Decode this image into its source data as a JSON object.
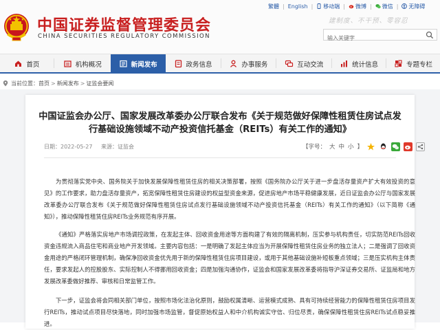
{
  "header": {
    "cn_title": "中国证券监督管理委员会",
    "en_title": "CHINA SECURITIES REGULATORY COMMISSION",
    "slogan": "建制度、不干预、零容忍",
    "top_links": {
      "traditional": "繁體",
      "english": "English",
      "mobile": "移动端",
      "weibo": "微博",
      "wechat": "微信",
      "accessibility": "无障碍"
    },
    "search_placeholder": "输入关键字"
  },
  "nav": {
    "items": [
      {
        "label": "首页",
        "icon": "home-icon"
      },
      {
        "label": "机构概况",
        "icon": "organization-icon"
      },
      {
        "label": "新闻发布",
        "icon": "news-icon",
        "active": true
      },
      {
        "label": "政务信息",
        "icon": "government-info-icon"
      },
      {
        "label": "办事服务",
        "icon": "service-icon"
      },
      {
        "label": "互动交流",
        "icon": "interaction-icon"
      },
      {
        "label": "统计信息",
        "icon": "statistics-icon"
      },
      {
        "label": "专题专栏",
        "icon": "topics-icon"
      }
    ],
    "active_color": "#2c5fa8"
  },
  "breadcrumb": {
    "prefix": "当前位置：",
    "items": [
      "首页",
      "新闻发布",
      "证监会要闻"
    ],
    "separator": ">"
  },
  "article": {
    "title": "中国证监会办公厅、国家发展改革委办公厅联合发布《关于规范做好保障性租赁住房试点发行基础设施领域不动产投资信托基金（REITs）有关工作的通知》",
    "date": "日期：2022-05-27",
    "source": "来源：证监会",
    "font_size_label": "【字号：",
    "font_sizes": [
      "大",
      "中",
      "小"
    ],
    "font_size_close": "】",
    "paragraphs": [
      "为贯彻落实党中央、国务院关于加快发展保障性租赁住房的相关决策部署，按照《国务院办公厅关于进一步盘活存量资产扩大有效投资的意见》的工作要求，助力盘活存量资产，拓宽保障性租赁住房建设的权益型资金来源，促进房地产市场平稳健康发展，近日证监会办公厅与国家发展改革委办公厅联合发布《关于规范做好保障性租赁住房试点发行基础设施领域不动产投资信托基金（REITs）有关工作的通知》（以下简称《通知》），推动保障性租赁住房REITs业务规范有序开展。",
      "《通知》严格落实房地产市场调控政策，在发起主体、回收资金用途等方面构建了有效的隔离机制，压实参与机构责任，切实防范REITs回收资金违规流入商品住宅和商业地产开发领域。主要内容包括：一是明确了发起主体应当为开展保障性租赁住房业务的独立法人；二是强调了回收资金用途的严格闭环管理机制，确保净回收资金优先用于新的保障性租赁住房项目建设，或用于其他基础设施补短板重点领域；三是压实机构主体责任，要求发起人的控股股东、实际控制人不得挪用回收资金；四是加强沟通协作，证监会和国家发展改革委将指导沪深证券交易所、证监局和地方发展改革委做好推荐、审核和日常监管工作。",
      "下一步，证监会将会同相关部门单位，按照市场化法治化原则，鼓励权属清晰、运营模式成熟、具有可持续经营能力的保障性租赁住房项目发行REITs，推动试点项目尽快落地，同时加强市场监管，督促原始权益人和中介机构诚实守信、归位尽责，确保保障性租赁住房REITs试点稳妥推进。"
    ]
  }
}
